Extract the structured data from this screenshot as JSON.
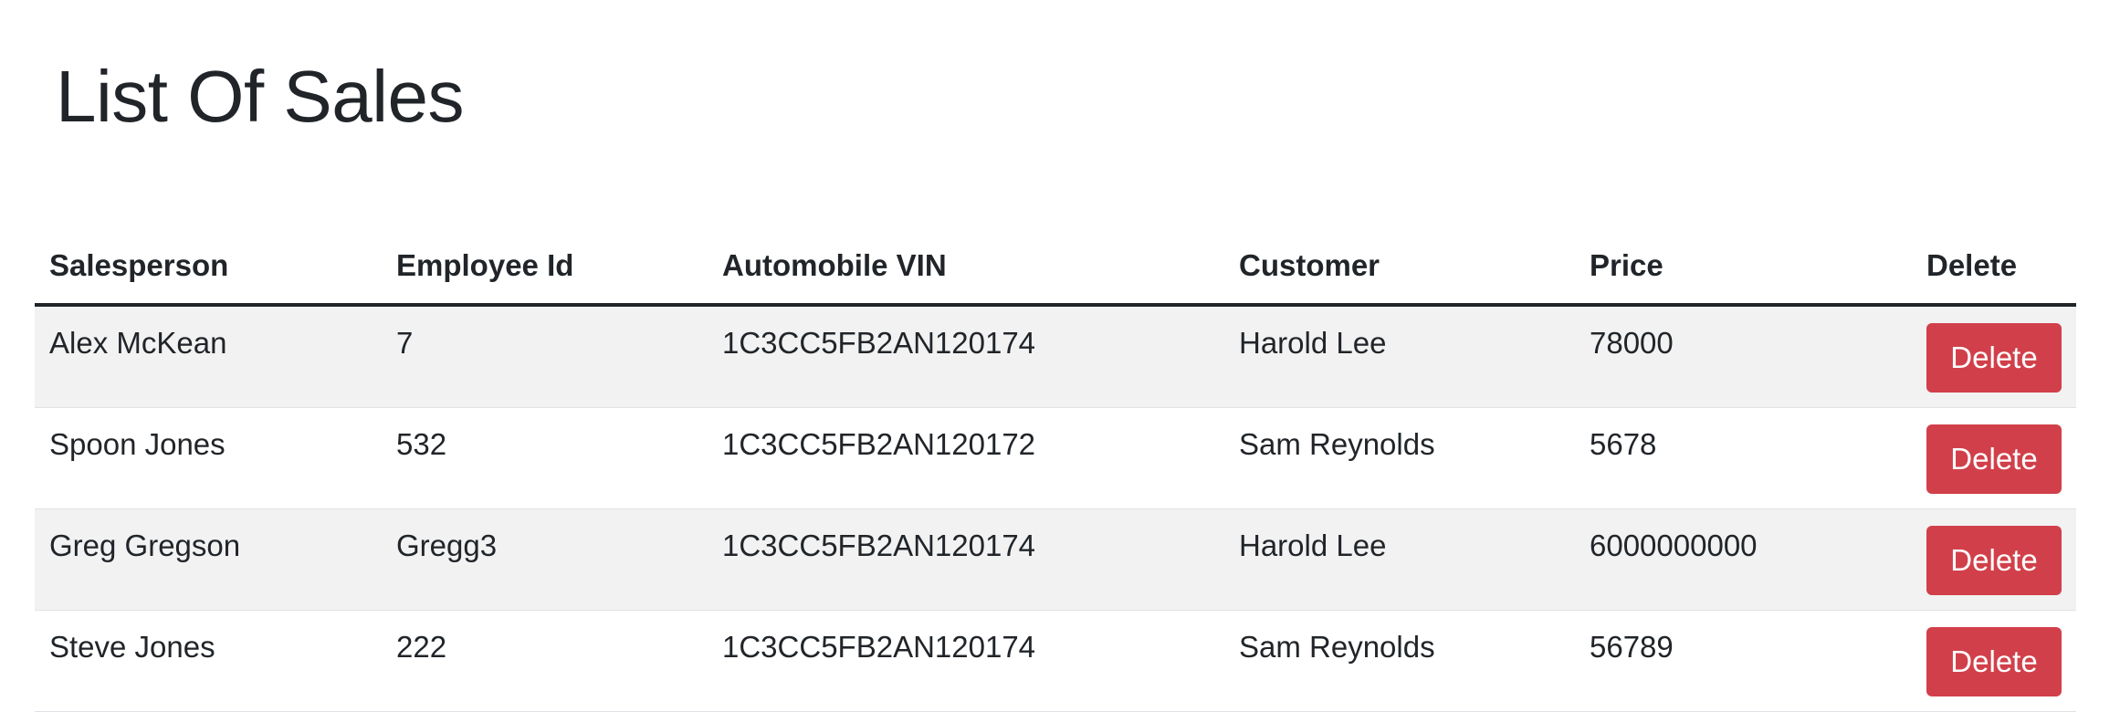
{
  "page": {
    "title": "List Of Sales"
  },
  "table": {
    "headers": [
      "Salesperson",
      "Employee Id",
      "Automobile VIN",
      "Customer",
      "Price",
      "Delete"
    ],
    "rows": [
      {
        "salesperson": "Alex McKean",
        "employee_id": "7",
        "vin": "1C3CC5FB2AN120174",
        "customer": "Harold Lee",
        "price": "78000",
        "delete_label": "Delete"
      },
      {
        "salesperson": "Spoon Jones",
        "employee_id": "532",
        "vin": "1C3CC5FB2AN120172",
        "customer": "Sam Reynolds",
        "price": "5678",
        "delete_label": "Delete"
      },
      {
        "salesperson": "Greg Gregson",
        "employee_id": "Gregg3",
        "vin": "1C3CC5FB2AN120174",
        "customer": "Harold Lee",
        "price": "6000000000",
        "delete_label": "Delete"
      },
      {
        "salesperson": "Steve Jones",
        "employee_id": "222",
        "vin": "1C3CC5FB2AN120174",
        "customer": "Sam Reynolds",
        "price": "56789",
        "delete_label": "Delete"
      }
    ]
  },
  "colors": {
    "text": "#212529",
    "stripe": "#f2f2f2",
    "delete_button": "#d1404a",
    "delete_button_text": "#ffffff"
  }
}
